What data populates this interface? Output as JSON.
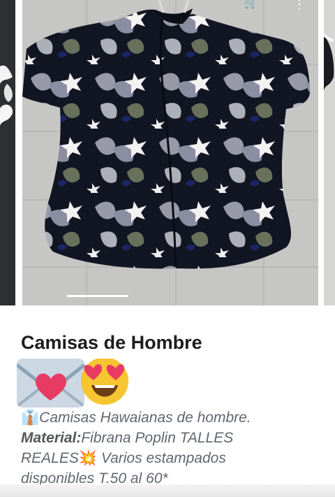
{
  "product": {
    "title": "Camisas de Hombre",
    "emojis": [
      "envelope-heart",
      "heart-eyes"
    ],
    "description": {
      "line1": "Camisas Hawaianas de hombre.",
      "material_label": "Material:",
      "material_text": "Fibrana Poplin TALLES",
      "line3_start": "REALES",
      "line3_end": " Varios estampados",
      "line4": "disponibles T.50 al 60*"
    }
  },
  "icons": {
    "tie": "tie-icon",
    "spark": "spark-icon",
    "cart": "cart-icon",
    "more": "more-icon"
  }
}
